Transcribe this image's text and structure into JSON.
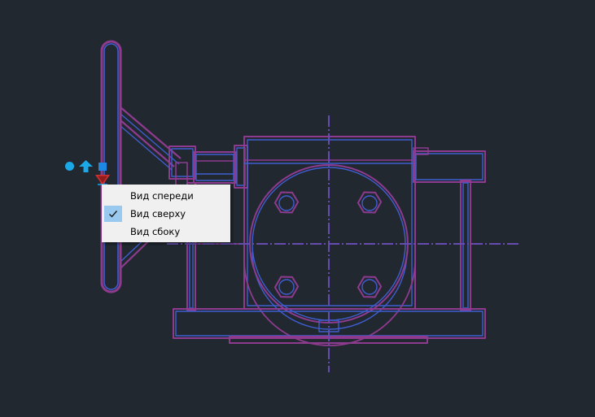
{
  "colors": {
    "background": "#212830",
    "drawing_outer": "#8e3b8f",
    "drawing_inner": "#3f5ed0",
    "grip_cyan": "#1aa9e6",
    "grip_blue": "#1e88e5",
    "grip_red": "#d32f2f",
    "menu_background": "#f0f0f0",
    "menu_check_highlight": "#99c9ef"
  },
  "grips": [
    {
      "name": "circle-grip-icon"
    },
    {
      "name": "arrow-up-grip-icon"
    },
    {
      "name": "square-grip-icon"
    },
    {
      "name": "triangle-down-grip-icon"
    }
  ],
  "context_menu": {
    "items": [
      {
        "label": "Вид спереди",
        "checked": false
      },
      {
        "label": "Вид сверху",
        "checked": true
      },
      {
        "label": "Вид сбоку",
        "checked": false
      }
    ]
  }
}
